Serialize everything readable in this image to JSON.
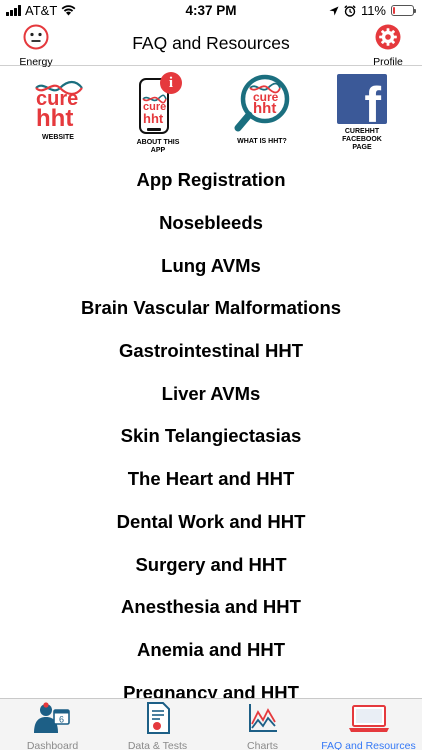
{
  "status_bar": {
    "carrier": "AT&T",
    "time": "4:37 PM",
    "battery_percent": "11%",
    "battery_level": 0.11,
    "battery_color": "#e5393d"
  },
  "nav": {
    "title": "FAQ and Resources",
    "left_label": "Energy",
    "right_label": "Profile",
    "profile_icon_color": "#e5393d"
  },
  "resources": [
    {
      "label": "WEBSITE",
      "icon": "curehht-logo-icon",
      "logo_top": "cure",
      "logo_bottom": "hht"
    },
    {
      "label": "ABOUT THIS APP",
      "icon": "phone-info-icon",
      "logo_top": "cure",
      "logo_bottom": "hht",
      "badge": "i"
    },
    {
      "label": "WHAT IS HHT?",
      "icon": "magnifier-icon",
      "logo_top": "cure",
      "logo_bottom": "hht"
    },
    {
      "label": "CUREHHT FACEBOOK PAGE",
      "icon": "facebook-icon",
      "glyph": "f"
    }
  ],
  "topics": [
    "App Registration",
    "Nosebleeds",
    "Lung AVMs",
    "Brain Vascular Malformations",
    "Gastrointestinal HHT",
    "Liver AVMs",
    "Skin Telangiectasias",
    "The Heart and HHT",
    "Dental Work and HHT",
    "Surgery and HHT",
    "Anesthesia and HHT",
    "Anemia and HHT",
    "Pregnancy and HHT"
  ],
  "tabs": [
    {
      "label": "Dashboard",
      "icon": "doctor-calendar-icon",
      "badge": "6"
    },
    {
      "label": "Data & Tests",
      "icon": "test-document-icon"
    },
    {
      "label": "Charts",
      "icon": "chart-icon"
    },
    {
      "label": "FAQ and Resources",
      "icon": "laptop-icon",
      "active": true
    }
  ],
  "colors": {
    "brand_red": "#e5393d",
    "teal": "#1b6f7f",
    "facebook_blue": "#3b5998",
    "active_tab": "#3478f6"
  }
}
